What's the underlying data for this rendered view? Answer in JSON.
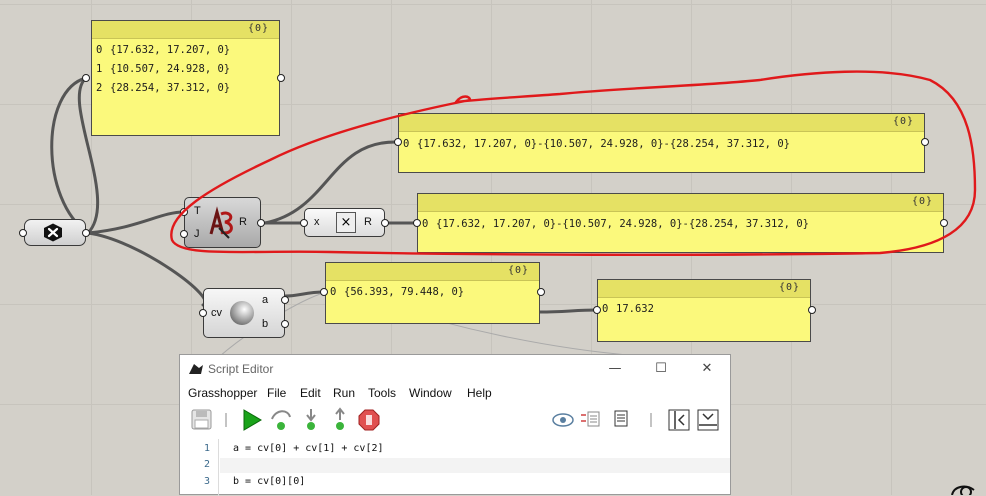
{
  "canvas": {
    "background": "#d3d0c9"
  },
  "panels": {
    "points": {
      "index_tag": "{0}",
      "rows": [
        {
          "idx": "0",
          "text": "{17.632, 17.207, 0}"
        },
        {
          "idx": "1",
          "text": "{10.507, 24.928, 0}"
        },
        {
          "idx": "2",
          "text": "{28.254, 37.312, 0}"
        }
      ]
    },
    "tree_result": {
      "index_tag": "{0}",
      "rows": [
        {
          "idx": "0",
          "text": "{17.632, 17.207, 0}-{10.507, 24.928, 0}-{28.254, 37.312, 0}"
        }
      ]
    },
    "multiply_result": {
      "index_tag": "{0}",
      "rows": [
        {
          "idx": "0",
          "text": "{17.632, 17.207, 0}-{10.507, 24.928, 0}-{28.254, 37.312, 0}"
        }
      ]
    },
    "script_a": {
      "index_tag": "{0}",
      "rows": [
        {
          "idx": "0",
          "text": "{56.393, 79.448, 0}"
        }
      ]
    },
    "script_b": {
      "index_tag": "{0}",
      "rows": [
        {
          "idx": "0",
          "text": "17.632"
        }
      ]
    }
  },
  "components": {
    "tree": {
      "in_t": "T",
      "in_j": "J",
      "out_r": "R"
    },
    "multiply": {
      "in_x": "x",
      "center": "×",
      "out_r": "R"
    },
    "script": {
      "in": "cv",
      "out_a": "a",
      "out_b": "b"
    }
  },
  "annotation": {
    "color": "#e0191b"
  },
  "editor": {
    "title": "Script Editor",
    "menu": [
      "Grasshopper",
      "File",
      "Edit",
      "Run",
      "Tools",
      "Window",
      "Help"
    ],
    "code": [
      {
        "num": "1",
        "text": "a = cv[0] + cv[1] + cv[2]"
      },
      {
        "num": "2",
        "text": ""
      },
      {
        "num": "3",
        "text": "b = cv[0][0]"
      }
    ],
    "minimize": "—",
    "maximize": "☐",
    "close": "✕"
  }
}
